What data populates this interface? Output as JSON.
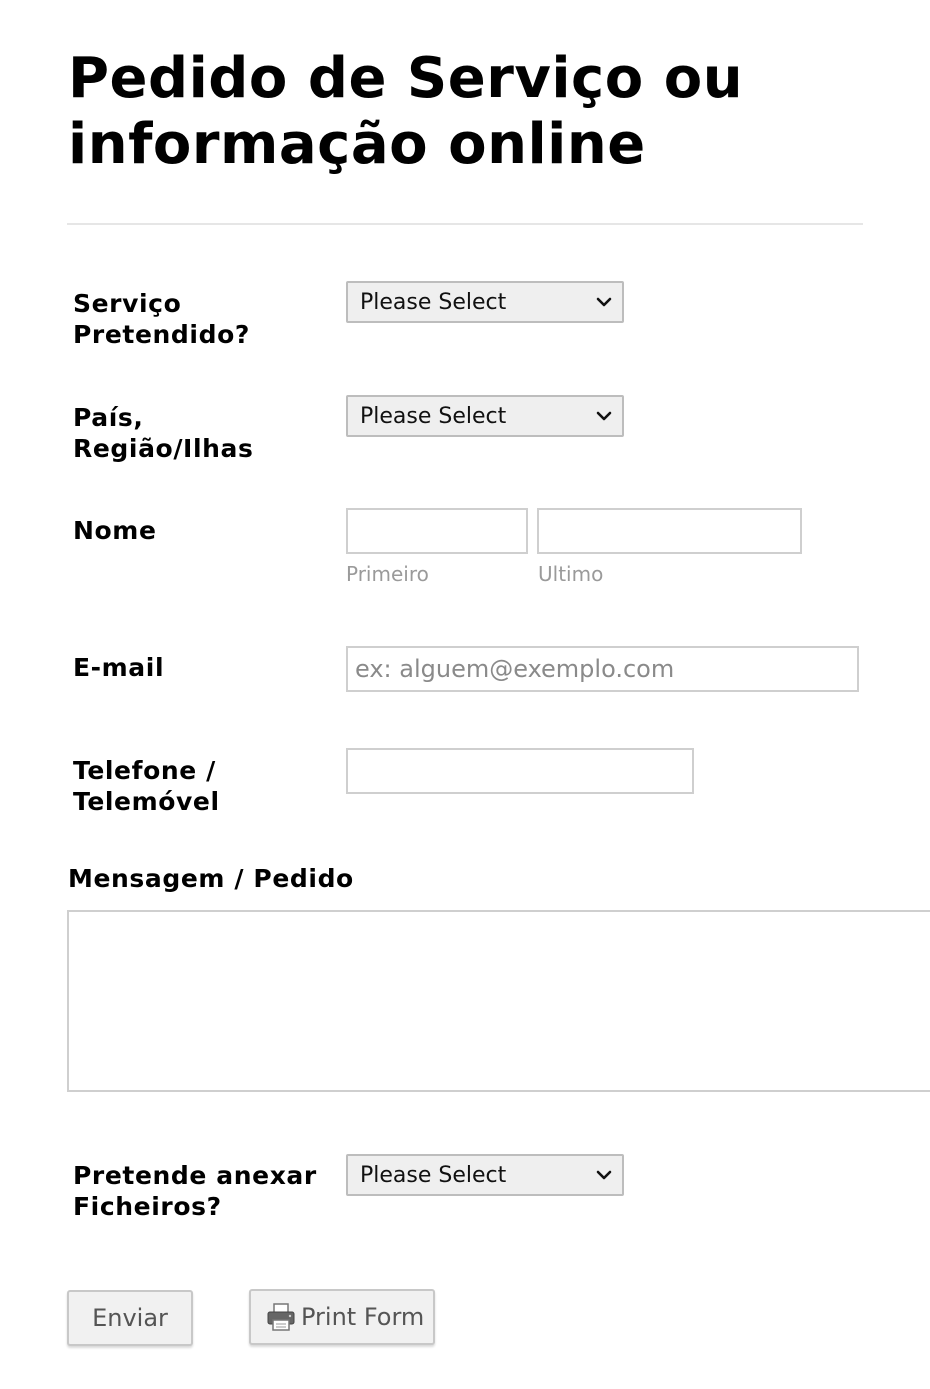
{
  "form": {
    "title_line1": "Pedido de Serviço ou",
    "title_line2": "informação online"
  },
  "fields": {
    "servico": {
      "label": "Serviço Pretendido?",
      "selected": "Please Select"
    },
    "pais": {
      "label": "País, Região/Ilhas",
      "selected": "Please Select"
    },
    "nome": {
      "label": "Nome",
      "first_value": "",
      "last_value": "",
      "first_sublabel": "Primeiro",
      "last_sublabel": "Ultimo"
    },
    "email": {
      "label": "E-mail",
      "value": "",
      "placeholder": "ex: alguem@exemplo.com"
    },
    "telefone": {
      "label": "Telefone / Telemóvel",
      "value": ""
    },
    "mensagem": {
      "label": "Mensagem / Pedido",
      "value": ""
    },
    "anexar": {
      "label": "Pretende anexar Ficheiros?",
      "selected": "Please Select"
    }
  },
  "buttons": {
    "submit_label": "Enviar",
    "print_label": "Print Form"
  },
  "icons": {
    "select_arrow": "chevron-down-icon",
    "print": "printer-icon"
  },
  "colors": {
    "border": "#cfcfcf",
    "select_bg": "#efefef",
    "button_bg": "#f1f1f1",
    "sublabel": "#9a9a9a"
  }
}
